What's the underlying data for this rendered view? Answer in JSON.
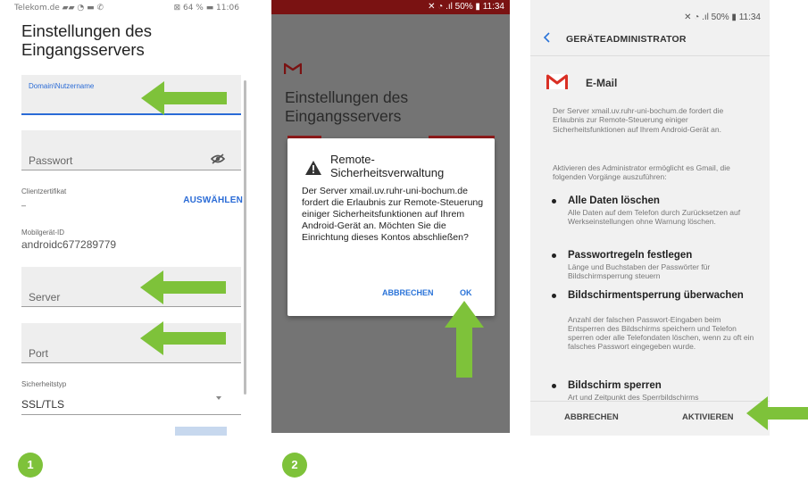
{
  "colors": {
    "arrow_green": "#7ec23a",
    "accent_blue": "#2a6bd6",
    "gmail_red": "#d93025",
    "status_red": "#7a1212"
  },
  "screen1": {
    "status_left": "Telekom.de ▰▰ ◔ ▬ ✆",
    "status_right": "⊠ 64 % ▬ 11:06",
    "title": "Einstellungen des Eingangsservers",
    "domain_label": "Domain\\Nutzername",
    "password_label": "Passwort",
    "client_cert_label": "Clientzertifikat",
    "client_cert_value": "–",
    "choose_button": "AUSWÄHLEN",
    "device_id_label": "Mobilgerät-ID",
    "device_id_value": "androidc677289779",
    "server_label": "Server",
    "port_label": "Port",
    "security_type_label": "Sicherheitstyp",
    "security_type_value": "SSL/TLS",
    "icons": {
      "visibility": "eye-off-icon"
    }
  },
  "screen2": {
    "status_right": "✕ ◔ .ıl 50% ▮ 11:34",
    "bg_title": "Einstellungen des Eingangsservers",
    "dialog": {
      "title": "Remote-Sicherheitsverwaltung",
      "body": "Der Server xmail.uv.ruhr-uni-bochum.de fordert die Erlaubnis zur Remote-Steuerung einiger Sicherheitsfunktionen auf Ihrem Android-Gerät an. Möchten Sie die Einrichtung dieses Kontos abschließen?",
      "cancel": "ABBRECHEN",
      "ok": "OK"
    },
    "icons": {
      "warning": "warning-icon",
      "logo": "gmail-logo-icon"
    }
  },
  "screen3": {
    "status_right": "✕ ◔ .ıl 50% ▮ 11:34",
    "header": "GERÄTEADMINISTRATOR",
    "app_name": "E-Mail",
    "intro": "Der Server xmail.uv.ruhr-uni-bochum.de fordert die Erlaubnis zur Remote-Steuerung einiger Sicherheitsfunktionen auf Ihrem Android-Gerät an.",
    "activate_text": "Aktivieren des Administrator ermöglicht es Gmail, die folgenden Vorgänge auszuführen:",
    "items": [
      {
        "title": "Alle Daten löschen",
        "desc": "Alle Daten auf dem Telefon durch Zurücksetzen auf Werkseinstellungen ohne Warnung löschen."
      },
      {
        "title": "Passwortregeln festlegen",
        "desc": "Länge und Buchstaben der Passwörter für Bildschirmsperrung steuern"
      },
      {
        "title": "Bildschirmentsperrung überwachen",
        "desc": "Anzahl der falschen Passwort-Eingaben beim Entsperren des Bildschirms speichern und Telefon sperren oder alle Telefondaten löschen, wenn zu oft ein falsches Passwort eingegeben wurde."
      },
      {
        "title": "Bildschirm sperren",
        "desc": "Art und Zeitpunkt des Sperrbildschirms"
      }
    ],
    "cancel": "ABBRECHEN",
    "activate": "AKTIVIEREN",
    "icons": {
      "back": "back-chevron-icon",
      "logo": "gmail-logo-icon"
    }
  },
  "steps": [
    "1",
    "2"
  ]
}
